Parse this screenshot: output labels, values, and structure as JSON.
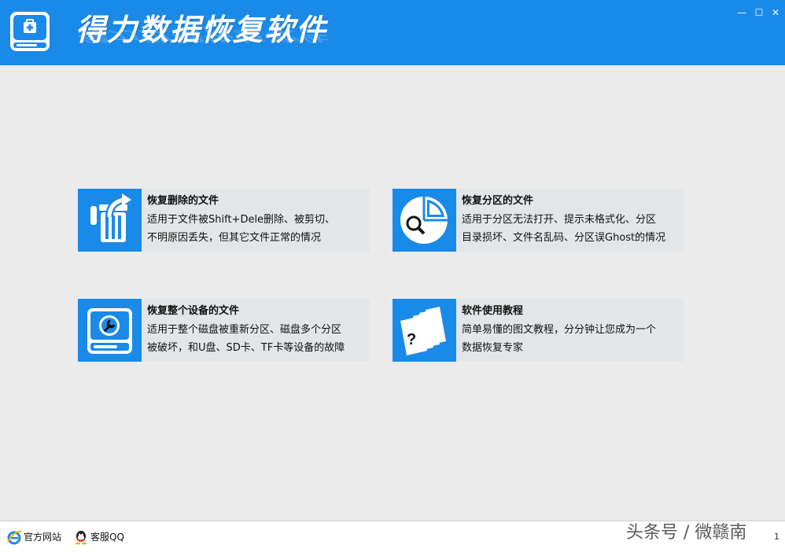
{
  "app": {
    "title": "得力数据恢复软件"
  },
  "window_controls": {
    "minimize": "—",
    "maximize": "☐",
    "close": "✕"
  },
  "cards": [
    {
      "title": "恢复删除的文件",
      "desc_line1": "适用于文件被Shift+Dele删除、被剪切、",
      "desc_line2": "不明原因丢失，但其它文件正常的情况",
      "icon": "trash-restore-icon"
    },
    {
      "title": "恢复分区的文件",
      "desc_line1": "适用于分区无法打开、提示未格式化、分区",
      "desc_line2": "目录损坏、文件名乱码、分区误Ghost的情况",
      "icon": "partition-search-icon"
    },
    {
      "title": "恢复整个设备的文件",
      "desc_line1": "适用于整个磁盘被重新分区、磁盘多个分区",
      "desc_line2": "被破坏，和U盘、SD卡、TF卡等设备的故障",
      "icon": "disk-wrench-icon"
    },
    {
      "title": "软件使用教程",
      "desc_line1": "简单易懂的图文教程，分分钟让您成为一个",
      "desc_line2": "数据恢复专家",
      "icon": "tutorial-pages-icon"
    }
  ],
  "statusbar": {
    "website_label": "官方网站",
    "qq_label": "客服QQ",
    "page_number": "1"
  },
  "watermark": "头条号 / 微赣南",
  "colors": {
    "brand_blue": "#1a8ae9",
    "background": "#ebebeb",
    "card_bg": "#e3e6e8"
  }
}
